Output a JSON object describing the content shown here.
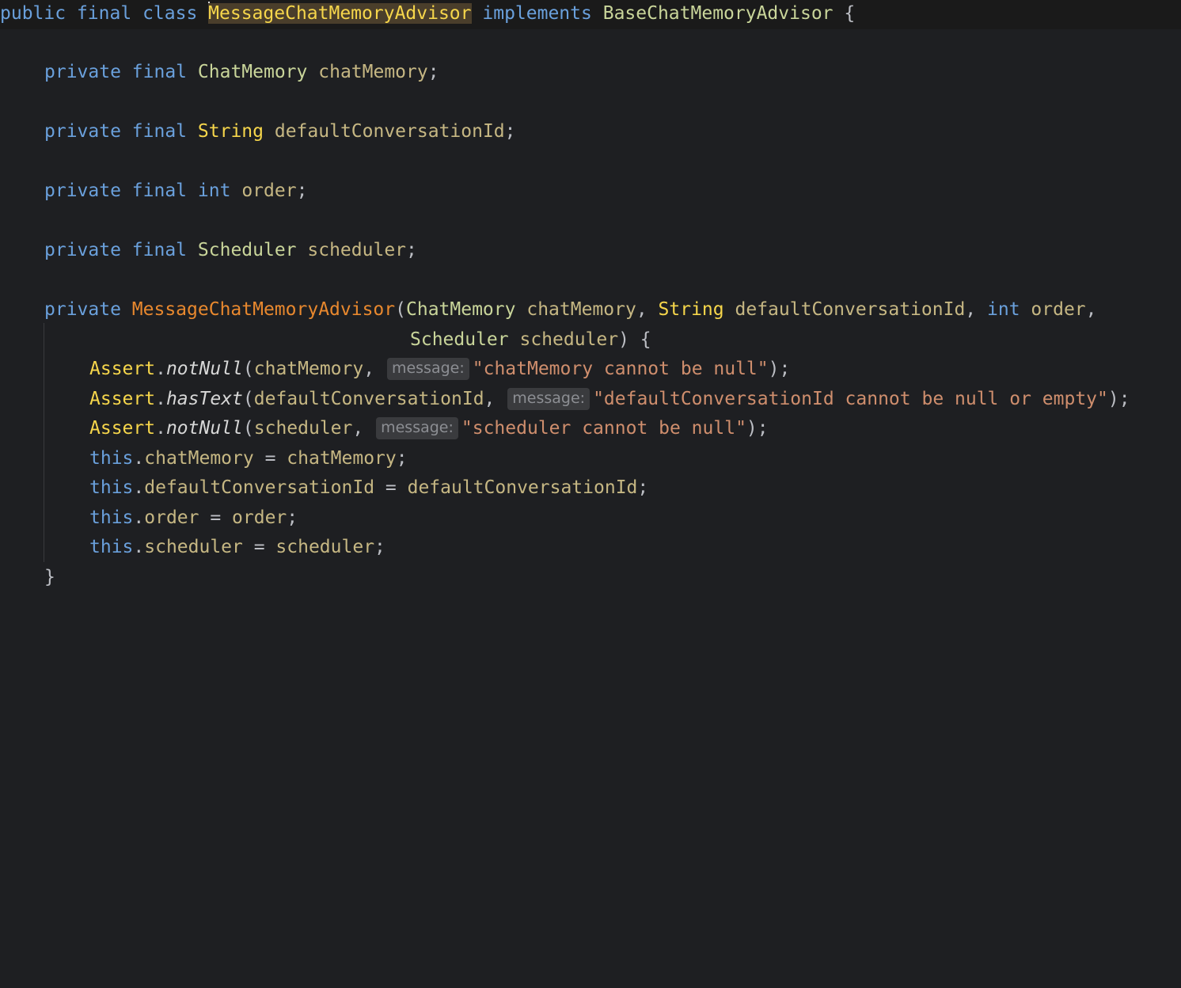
{
  "code": {
    "class_decl": {
      "public": "public",
      "final": "final",
      "class": "class",
      "name": "MessageChatMemoryAdvisor",
      "implements": "implements",
      "interface": "BaseChatMemoryAdvisor",
      "open_brace": "{"
    },
    "fields": [
      {
        "private": "private",
        "final": "final",
        "type": "ChatMemory",
        "name": "chatMemory",
        "semi": ";"
      },
      {
        "private": "private",
        "final": "final",
        "type": "String",
        "name": "defaultConversationId",
        "semi": ";"
      },
      {
        "private": "private",
        "final": "final",
        "type": "int",
        "name": "order",
        "semi": ";"
      },
      {
        "private": "private",
        "final": "final",
        "type": "Scheduler",
        "name": "scheduler",
        "semi": ";"
      }
    ],
    "constructor": {
      "private": "private",
      "name": "MessageChatMemoryAdvisor",
      "open_paren": "(",
      "p1_type": "ChatMemory",
      "p1_name": "chatMemory",
      "comma": ",",
      "p2_type": "String",
      "p2_name": "defaultConversationId",
      "p3_type": "int",
      "p3_name": "order",
      "p4_type": "Scheduler",
      "p4_name": "scheduler",
      "close_paren_brace": ") {",
      "close_brace": "}"
    },
    "asserts": [
      {
        "cls": "Assert",
        "dot": ".",
        "method": "notNull",
        "open": "(",
        "arg": "chatMemory",
        "comma": ",",
        "hint": "message:",
        "msg": "\"chatMemory cannot be null\"",
        "close": ");"
      },
      {
        "cls": "Assert",
        "dot": ".",
        "method": "hasText",
        "open": "(",
        "arg": "defaultConversationId",
        "comma": ",",
        "hint": "message:",
        "msg": "\"defaultConversationId cannot be null or empty\"",
        "close": ");"
      },
      {
        "cls": "Assert",
        "dot": ".",
        "method": "notNull",
        "open": "(",
        "arg": "scheduler",
        "comma": ",",
        "hint": "message:",
        "msg": "\"scheduler cannot be null\"",
        "close": ");"
      }
    ],
    "assignments": [
      {
        "this": "this",
        "dot": ".",
        "field": "chatMemory",
        "eq": " = ",
        "value": "chatMemory",
        "semi": ";"
      },
      {
        "this": "this",
        "dot": ".",
        "field": "defaultConversationId",
        "eq": " = ",
        "value": "defaultConversationId",
        "semi": ";"
      },
      {
        "this": "this",
        "dot": ".",
        "field": "order",
        "eq": " = ",
        "value": "order",
        "semi": ";"
      },
      {
        "this": "this",
        "dot": ".",
        "field": "scheduler",
        "eq": " = ",
        "value": "scheduler",
        "semi": ";"
      }
    ]
  },
  "colors": {
    "background": "#1e1f22",
    "keyword": "#6aa0dc",
    "type": "#c9d59a",
    "string_type": "#f6d64b",
    "method_decl": "#e8882e",
    "string_literal": "#cf8e6d",
    "field": "#c6b783"
  }
}
